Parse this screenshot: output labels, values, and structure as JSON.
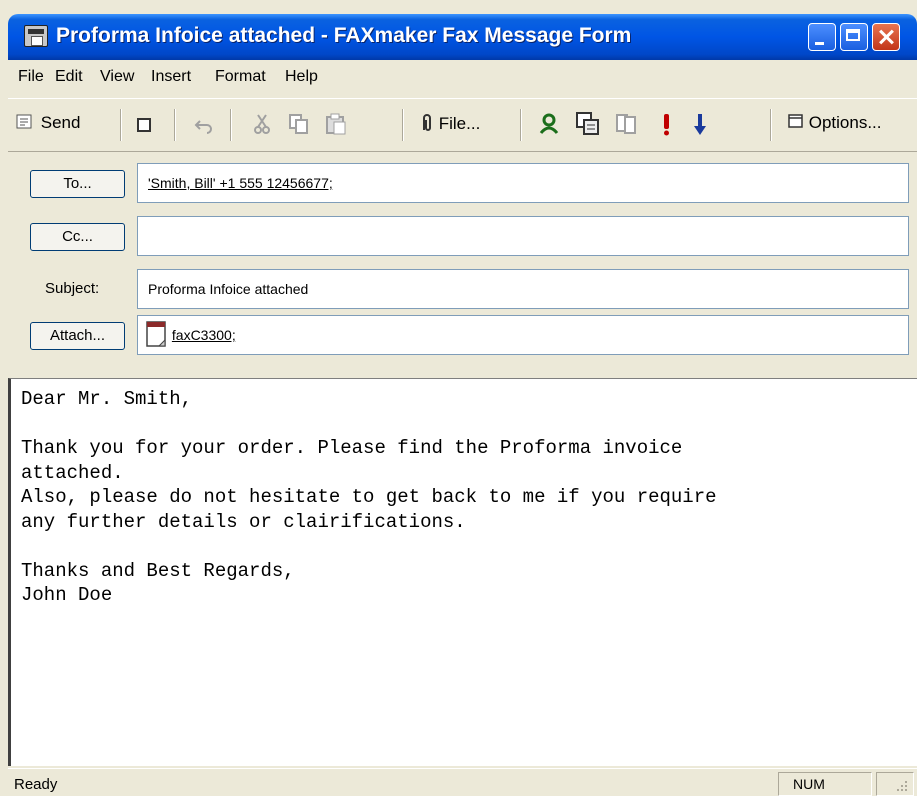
{
  "window": {
    "title": "Proforma Infoice attached - FAXmaker Fax Message Form"
  },
  "menu": [
    "File",
    "Edit",
    "View",
    "Insert",
    "Format",
    "Help"
  ],
  "toolbar": {
    "send_label": "Send",
    "file_label": "File...",
    "options_label": "Options..."
  },
  "header": {
    "to_button": "To...",
    "to_value": "'Smith, Bill' +1 555 12456677;",
    "cc_button": "Cc...",
    "cc_value": "",
    "subject_label": "Subject:",
    "subject_value": "Proforma Infoice attached",
    "attach_button": "Attach...",
    "attach_value": "faxC3300;"
  },
  "message": {
    "body": "Dear Mr. Smith,\n\nThank you for your order. Please find the Proforma invoice\nattached.\nAlso, please do not hesitate to get back to me if you require\nany further details or clairifications.\n\nThanks and Best Regards,\nJohn Doe"
  },
  "status": {
    "text": "Ready",
    "num": "NUM"
  }
}
